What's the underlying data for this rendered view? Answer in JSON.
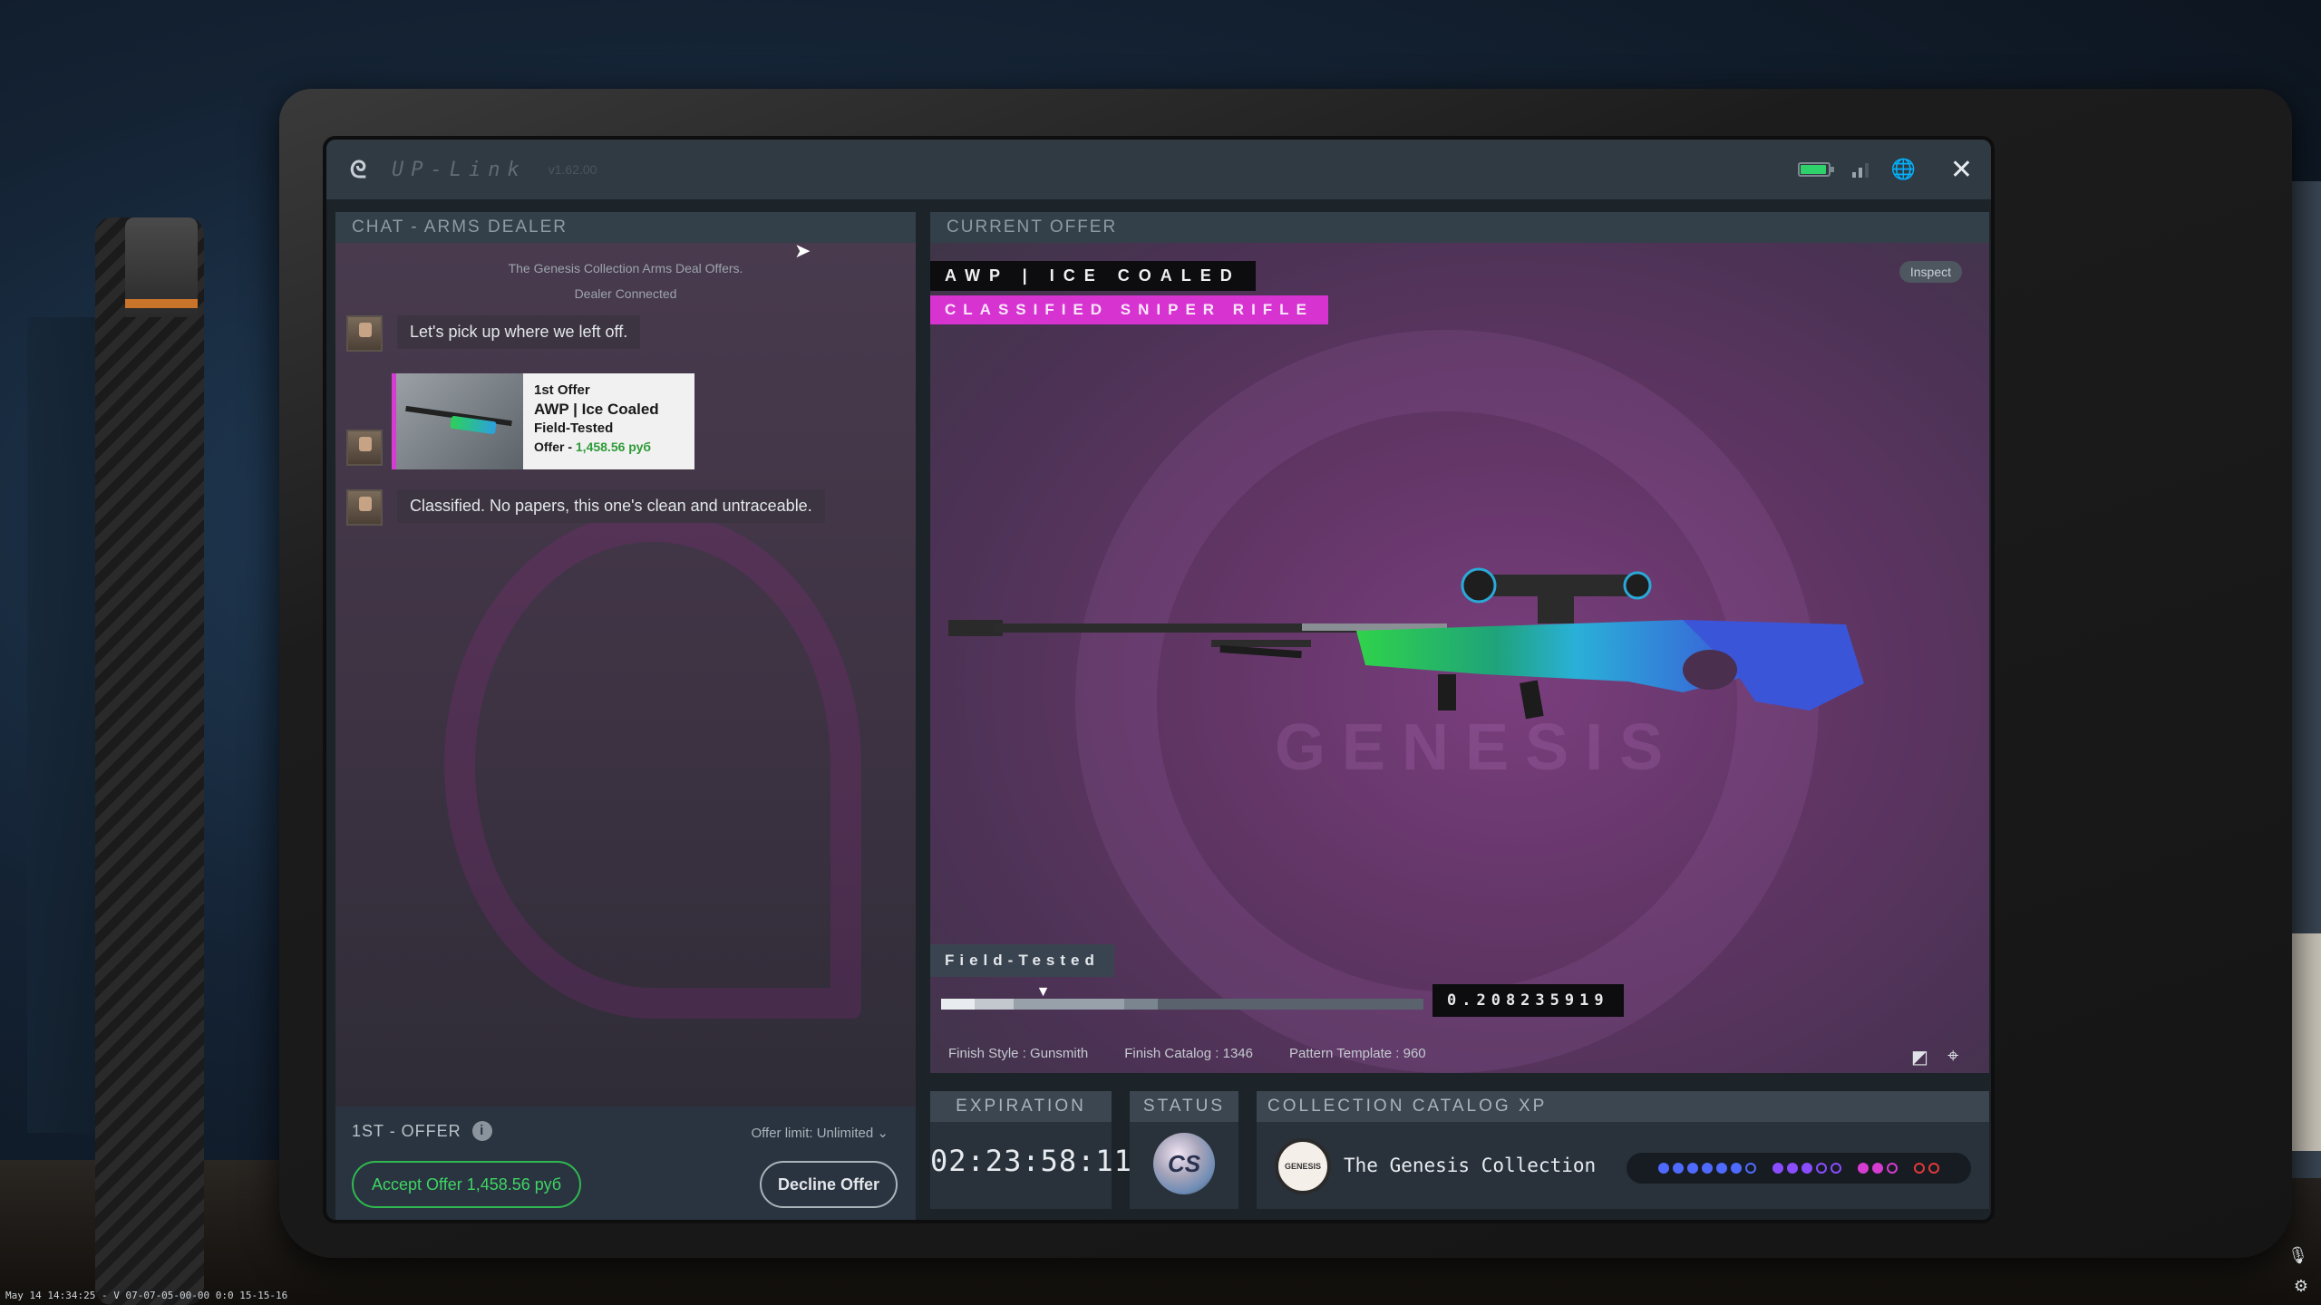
{
  "app": {
    "name": "UP-Link",
    "version": "v1.62.00"
  },
  "chat": {
    "header": "CHAT - ARMS DEALER",
    "system_messages": [
      "The Genesis Collection Arms Deal Offers.",
      "Dealer Connected"
    ],
    "messages": [
      {
        "text": "Let's pick up where we left off."
      },
      {
        "text": "Classified. No papers, this one's clean and untraceable."
      }
    ],
    "offer_card": {
      "line1": "1st Offer",
      "line2": "AWP | Ice Coaled",
      "line3": "Field-Tested",
      "offer_label": "Offer - ",
      "price": "1,458.56 руб"
    },
    "footer": {
      "label": "1ST - OFFER",
      "info_icon": "i",
      "offer_limit": "Offer limit: Unlimited",
      "accept_label": "Accept Offer 1,458.56 руб",
      "decline_label": "Decline Offer"
    }
  },
  "offer": {
    "header": "CURRENT OFFER",
    "weapon_name": "AWP  |  ICE COALED",
    "rarity": "CLASSIFIED SNIPER RIFLE",
    "inspect_label": "Inspect",
    "watermark": "GENESIS",
    "wear_label": "Field-Tested",
    "float_value": "0.208235919",
    "float_fraction": 0.208,
    "finish_style": "Finish Style : Gunsmith",
    "finish_catalog": "Finish Catalog : 1346",
    "pattern_template": "Pattern Template : 960",
    "colors": {
      "rarity": "#d633d0",
      "accept": "#3fd463",
      "price_green": "#2d9b36"
    }
  },
  "expiration": {
    "header": "EXPIRATION",
    "time": "02:23:58:11"
  },
  "status": {
    "header": "STATUS",
    "emblem": "CS"
  },
  "collection": {
    "header": "COLLECTION CATALOG XP",
    "emblem_text": "GENESIS",
    "name": "The Genesis Collection",
    "xp_groups": [
      {
        "color": "#4f6bff",
        "filled": 6,
        "empty": 1
      },
      {
        "color": "#8a4dff",
        "filled": 3,
        "empty": 2
      },
      {
        "color": "#d63cd1",
        "filled": 2,
        "empty": 1
      },
      {
        "color": "#e03a3a",
        "filled": 0,
        "empty": 2
      }
    ]
  },
  "debug": {
    "text": "May 14 14:34:25 - V 07-07-05-00-00 0:0 15-15-16"
  },
  "icons": [
    "logo-icon",
    "battery-icon",
    "signal-icon",
    "globe-icon",
    "close-icon",
    "info-icon",
    "chevron-down-icon",
    "sticker-icon",
    "target-icon",
    "mic-icon",
    "settings-icon"
  ]
}
